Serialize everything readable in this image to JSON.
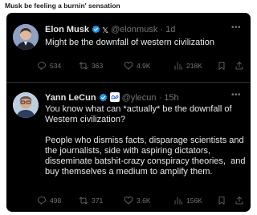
{
  "post": {
    "title": "Musk be feeling a burnin' sensation"
  },
  "tweets": [
    {
      "name": "Elon Musk",
      "handle": "@elonmusk",
      "time": "1d",
      "text": "Might be the downfall of western civilization",
      "stats": {
        "replies": "534",
        "retweets": "363",
        "likes": "4.9K",
        "views": "218K"
      },
      "verified_color": "#1d9bf0"
    },
    {
      "name": "Yann LeCun",
      "handle": "@ylecun",
      "time": "15h",
      "text": "You know what can *actually* be the downfall of Western civilization?\n\nPeople who dismiss facts, disparage scientists and the journalists, side with aspiring dictators, disseminate batshit-crazy conspiracy theories,  and buy themselves a medium to amplify them.",
      "stats": {
        "replies": "498",
        "retweets": "371",
        "likes": "3.6K",
        "views": "156K"
      },
      "verified_color": "#1d9bf0"
    }
  ],
  "colors": {
    "card_bg": "#000000",
    "text": "#e7e9ea",
    "muted": "#71767b",
    "accent": "#1d9bf0"
  },
  "icons": [
    "verified-badge-icon",
    "x-logo-icon",
    "meta-logo-icon",
    "more-icon",
    "reply-icon",
    "retweet-icon",
    "like-icon",
    "views-icon",
    "bookmark-icon",
    "share-icon"
  ]
}
